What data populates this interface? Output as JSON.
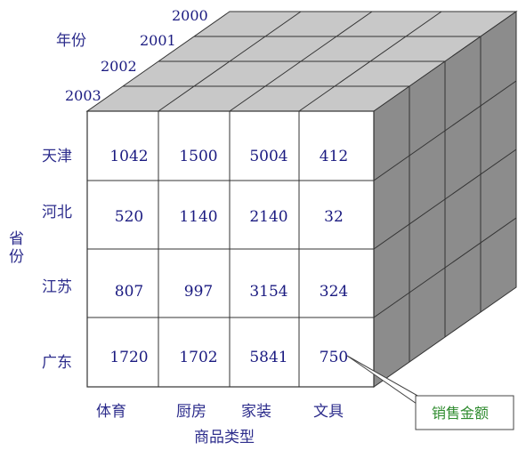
{
  "cube": {
    "years": [
      "2000",
      "2001",
      "2002",
      "2003"
    ],
    "year_axis_label": "年份",
    "provinces": [
      "天津",
      "河北",
      "江苏",
      "广东"
    ],
    "province_axis_label": "省份",
    "categories": [
      "体育",
      "厨房",
      "家装",
      "文具"
    ],
    "category_axis_label": "商品类型",
    "values": [
      [
        "1042",
        "1500",
        "5004",
        "412"
      ],
      [
        "520",
        "1140",
        "2140",
        "32"
      ],
      [
        "807",
        "997",
        "3154",
        "324"
      ],
      [
        "1720",
        "1702",
        "5841",
        "750"
      ]
    ],
    "measure_label": "销售金额"
  },
  "colors": {
    "top_face": "#c8c8c8",
    "side_face": "#8c8c8c",
    "front_face": "#ffffff",
    "value_text": "#1a1a80",
    "label_text": "#2d2d8c",
    "callout_text": "#2e8b2e"
  }
}
